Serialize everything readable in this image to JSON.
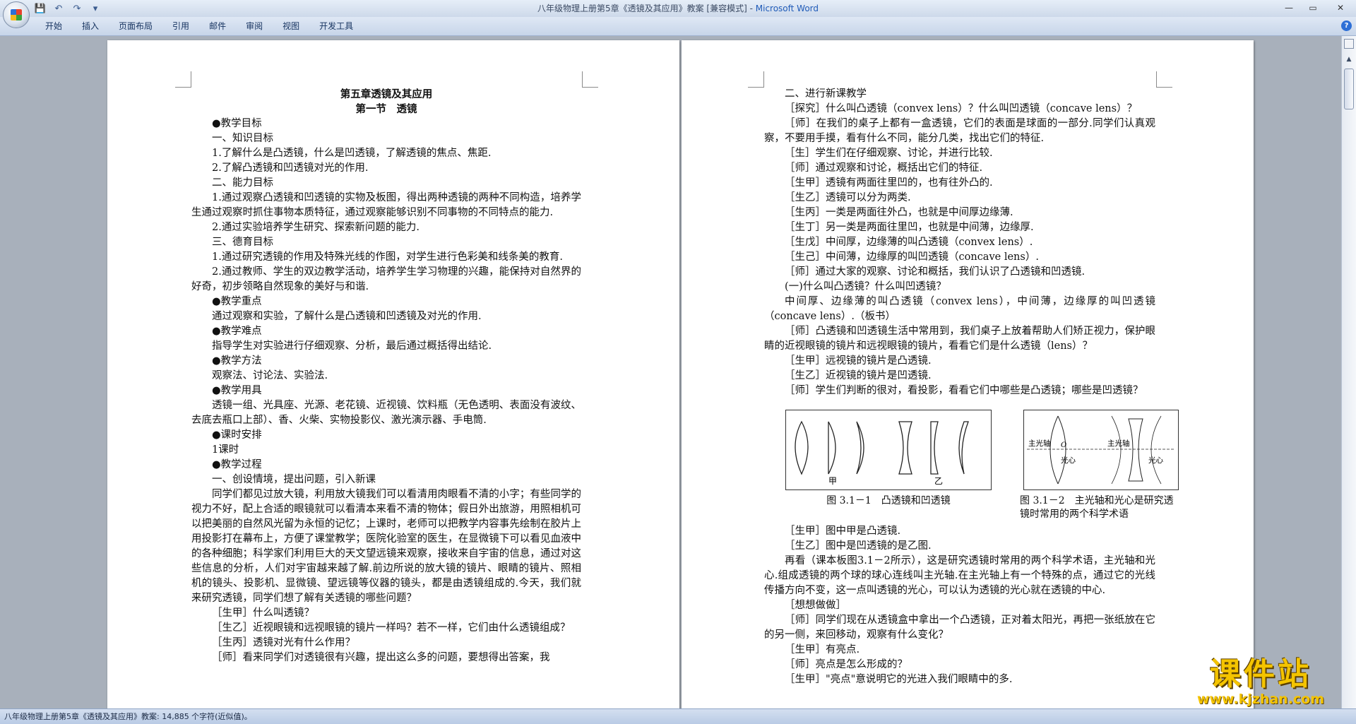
{
  "window": {
    "title_doc": "八年级物理上册第5章《透镜及其应用》教案 [兼容模式] - ",
    "title_app": "Microsoft Word",
    "minimize": "—",
    "maximize": "▭",
    "close": "✕"
  },
  "qat": {
    "save": "💾",
    "undo": "↶",
    "redo": "↷",
    "more": "▾"
  },
  "ribbon": {
    "tabs": [
      "开始",
      "插入",
      "页面布局",
      "引用",
      "邮件",
      "审阅",
      "视图",
      "开发工具"
    ],
    "help": "?"
  },
  "left_page": {
    "paragraphs": [
      {
        "t": "第五章透镜及其应用",
        "title": true
      },
      {
        "t": "第一节　透镜",
        "title": true
      },
      {
        "t": "●教学目标"
      },
      {
        "t": "一、知识目标"
      },
      {
        "t": "1.了解什么是凸透镜，什么是凹透镜，了解透镜的焦点、焦距."
      },
      {
        "t": "2.了解凸透镜和凹透镜对光的作用."
      },
      {
        "t": "二、能力目标"
      },
      {
        "t": "1.通过观察凸透镜和凹透镜的实物及板图，得出两种透镜的两种不同构造，培养学生通过观察时抓住事物本质特征，通过观察能够识别不同事物的不同特点的能力."
      },
      {
        "t": "2.通过实验培养学生研究、探索新问题的能力."
      },
      {
        "t": "三、德育目标"
      },
      {
        "t": "1.通过研究透镜的作用及特殊光线的作图，对学生进行色彩美和线条美的教育."
      },
      {
        "t": "2.通过教师、学生的双边教学活动，培养学生学习物理的兴趣，能保持对自然界的好奇，初步领略自然现象的美好与和谐."
      },
      {
        "t": "●教学重点"
      },
      {
        "t": "通过观察和实验，了解什么是凸透镜和凹透镜及对光的作用."
      },
      {
        "t": "●教学难点"
      },
      {
        "t": "指导学生对实验进行仔细观察、分析，最后通过概括得出结论."
      },
      {
        "t": "●教学方法"
      },
      {
        "t": "观察法、讨论法、实验法."
      },
      {
        "t": "●教学用具"
      },
      {
        "t": "透镜一组、光具座、光源、老花镜、近视镜、饮料瓶（无色透明、表面没有波纹、去底去瓶口上部）、香、火柴、实物投影仪、激光演示器、手电筒."
      },
      {
        "t": "●课时安排"
      },
      {
        "t": "1课时"
      },
      {
        "t": "●教学过程"
      },
      {
        "t": "一、创设情境，提出问题，引入新课"
      },
      {
        "t": "同学们都见过放大镜，利用放大镜我们可以看清用肉眼看不清的小字；有些同学的视力不好，配上合适的眼镜就可以看清本来看不清的物体；假日外出旅游，用照相机可以把美丽的自然风光留为永恒的记忆；上课时，老师可以把教学内容事先绘制在胶片上用投影打在幕布上，方便了课堂教学；医院化验室的医生，在显微镜下可以看见血液中的各种细胞；科学家们利用巨大的天文望远镜来观察，接收来自宇宙的信息，通过对这些信息的分析，人们对宇宙越来越了解.前边所说的放大镜的镜片、眼睛的镜片、照相机的镜头、投影机、显微镜、望远镜等仪器的镜头，都是由透镜组成的.今天，我们就来研究透镜，同学们想了解有关透镜的哪些问题？"
      },
      {
        "t": "［生甲］什么叫透镜？"
      },
      {
        "t": "［生乙］近视眼镜和远视眼镜的镜片一样吗？若不一样，它们由什么透镜组成？"
      },
      {
        "t": "［生丙］透镜对光有什么作用？"
      },
      {
        "t": "［师］看来同学们对透镜很有兴趣，提出这么多的问题，要想得出答案，我"
      }
    ]
  },
  "right_page": {
    "paragraphs_top": [
      {
        "t": "二、进行新课教学"
      },
      {
        "t": "［探究］什么叫凸透镜（convex lens）？什么叫凹透镜（concave lens）？"
      },
      {
        "t": "［师］在我们的桌子上都有一盒透镜，它们的表面是球面的一部分.同学们认真观察，不要用手摸，看有什么不同，能分几类，找出它们的特征."
      },
      {
        "t": "［生］学生们在仔细观察、讨论，并进行比较."
      },
      {
        "t": "［师］通过观察和讨论，概括出它们的特征."
      },
      {
        "t": "［生甲］透镜有两面往里凹的，也有往外凸的."
      },
      {
        "t": "［生乙］透镜可以分为两类."
      },
      {
        "t": "［生丙］一类是两面往外凸，也就是中间厚边缘薄."
      },
      {
        "t": "［生丁］另一类是两面往里凹，也就是中间薄，边缘厚."
      },
      {
        "t": "［生戊］中间厚，边缘薄的叫凸透镜（convex lens）."
      },
      {
        "t": "［生己］中间薄，边缘厚的叫凹透镜（concave lens）."
      },
      {
        "t": "［师］通过大家的观察、讨论和概括，我们认识了凸透镜和凹透镜."
      },
      {
        "t": "(一)什么叫凸透镜？什么叫凹透镜？"
      },
      {
        "t": "中间厚、边缘薄的叫凸透镜（convex lens），中间薄，边缘厚的叫凹透镜（concave lens）.（板书）"
      },
      {
        "t": "［师］凸透镜和凹透镜生活中常用到，我们桌子上放着帮助人们矫正视力，保护眼睛的近视眼镜的镜片和远视眼镜的镜片，看看它们是什么透镜（lens）？"
      },
      {
        "t": "［生甲］远视镜的镜片是凸透镜."
      },
      {
        "t": "［生乙］近视镜的镜片是凹透镜."
      },
      {
        "t": "［师］学生们判断的很对，看投影，看看它们中哪些是凸透镜；哪些是凹透镜？"
      }
    ],
    "figures": {
      "fig1_label_a": "甲",
      "fig1_label_b": "乙",
      "fig1_caption": "图 3.1－1　凸透镜和凹透镜",
      "fig2_axis_1": "主光轴",
      "fig2_axis_2": "主光轴",
      "fig2_o": "O",
      "fig2_center_1": "光心",
      "fig2_center_2": "光心",
      "fig2_caption": "图 3.1－2　主光轴和光心是研究透镜时常用的两个科学术语"
    },
    "paragraphs_bottom": [
      {
        "t": "［生甲］图中甲是凸透镜."
      },
      {
        "t": "［生乙］图中是凹透镜的是乙图."
      },
      {
        "t": "再看（课本板图3.1－2所示），这是研究透镜时常用的两个科学术语，主光轴和光心.组成透镜的两个球的球心连线叫主光轴.在主光轴上有一个特殊的点，通过它的光线传播方向不变，这一点叫透镜的光心，可以认为透镜的光心就在透镜的中心."
      },
      {
        "t": "［想想做做］"
      },
      {
        "t": "［师］同学们现在从透镜盒中拿出一个凸透镜，正对着太阳光，再把一张纸放在它的另一侧，来回移动，观察有什么变化？"
      },
      {
        "t": "［生甲］有亮点."
      },
      {
        "t": "［师］亮点是怎么形成的？"
      },
      {
        "t": "［生甲］\"亮点\"意说明它的光进入我们眼睛中的多."
      }
    ]
  },
  "statusbar": {
    "text": "八年级物理上册第5章《透镜及其应用》教案: 14,885 个字符(近似值)。"
  },
  "watermark": {
    "big": "课件站",
    "url": "www.kjzhan.com"
  },
  "scrollbar": {
    "up": "▲"
  }
}
